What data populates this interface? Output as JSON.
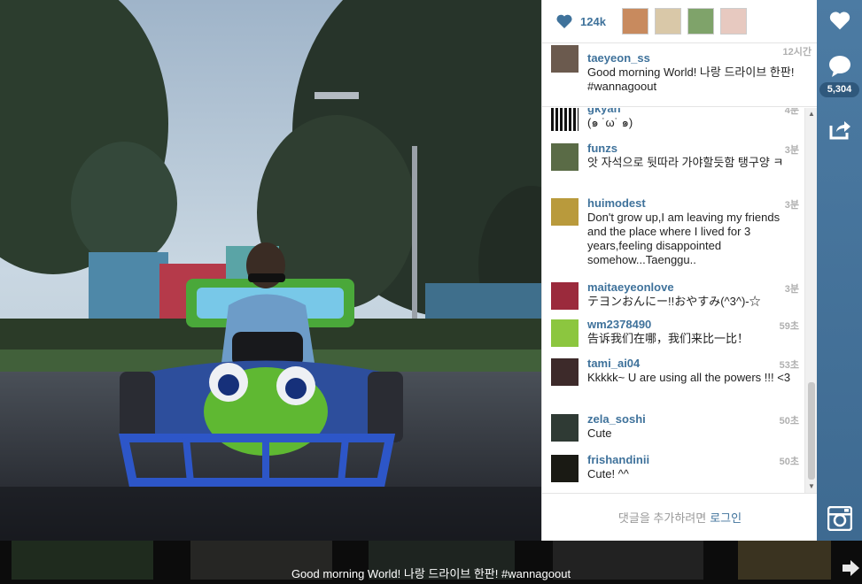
{
  "post": {
    "likes": "124k",
    "comment_count": "5,304",
    "caption": {
      "user": "taeyeon_ss",
      "time": "12시간",
      "text": "Good morning World! 나랑 드라이브 한판! #wannagoout"
    }
  },
  "comments": [
    {
      "user": "gkyan",
      "time": "4분",
      "text": "(๑ ˙ω˙ ๑)"
    },
    {
      "user": "funzs",
      "time": "3분",
      "text": "앗 자석으로 뒷따라 가야할듯함 탱구양 ㅋ"
    },
    {
      "user": "huimodest",
      "time": "3분",
      "text": "Don't grow up,I am leaving my friends and the place where I lived for 3 years,feeling disappointed somehow...Taenggu.."
    },
    {
      "user": "maitaeyeonlove",
      "time": "3분",
      "text": "テヨンおんにー!!おやすみ(^3^)-☆"
    },
    {
      "user": "wm2378490",
      "time": "59초",
      "text": "告诉我们在哪，我们来比一比！"
    },
    {
      "user": "tami_ai04",
      "time": "53초",
      "text": "Kkkkk~ U are using all the powers !!! <3"
    },
    {
      "user": "zela_soshi",
      "time": "50초",
      "text": "Cute"
    },
    {
      "user": "frishandinii",
      "time": "50초",
      "text": "Cute! ^^"
    }
  ],
  "login": {
    "prefix": "댓글을 추가하려면",
    "link": "로그인"
  },
  "strip": {
    "caption": "Good morning World! 나랑 드라이브 한판! #wannagoout"
  },
  "colors": {
    "accent": "#3f729b",
    "sidebar": "#4a78a0"
  },
  "icons": [
    "heart-icon",
    "comment-icon",
    "share-icon",
    "instagram-icon",
    "next-arrow-icon"
  ]
}
